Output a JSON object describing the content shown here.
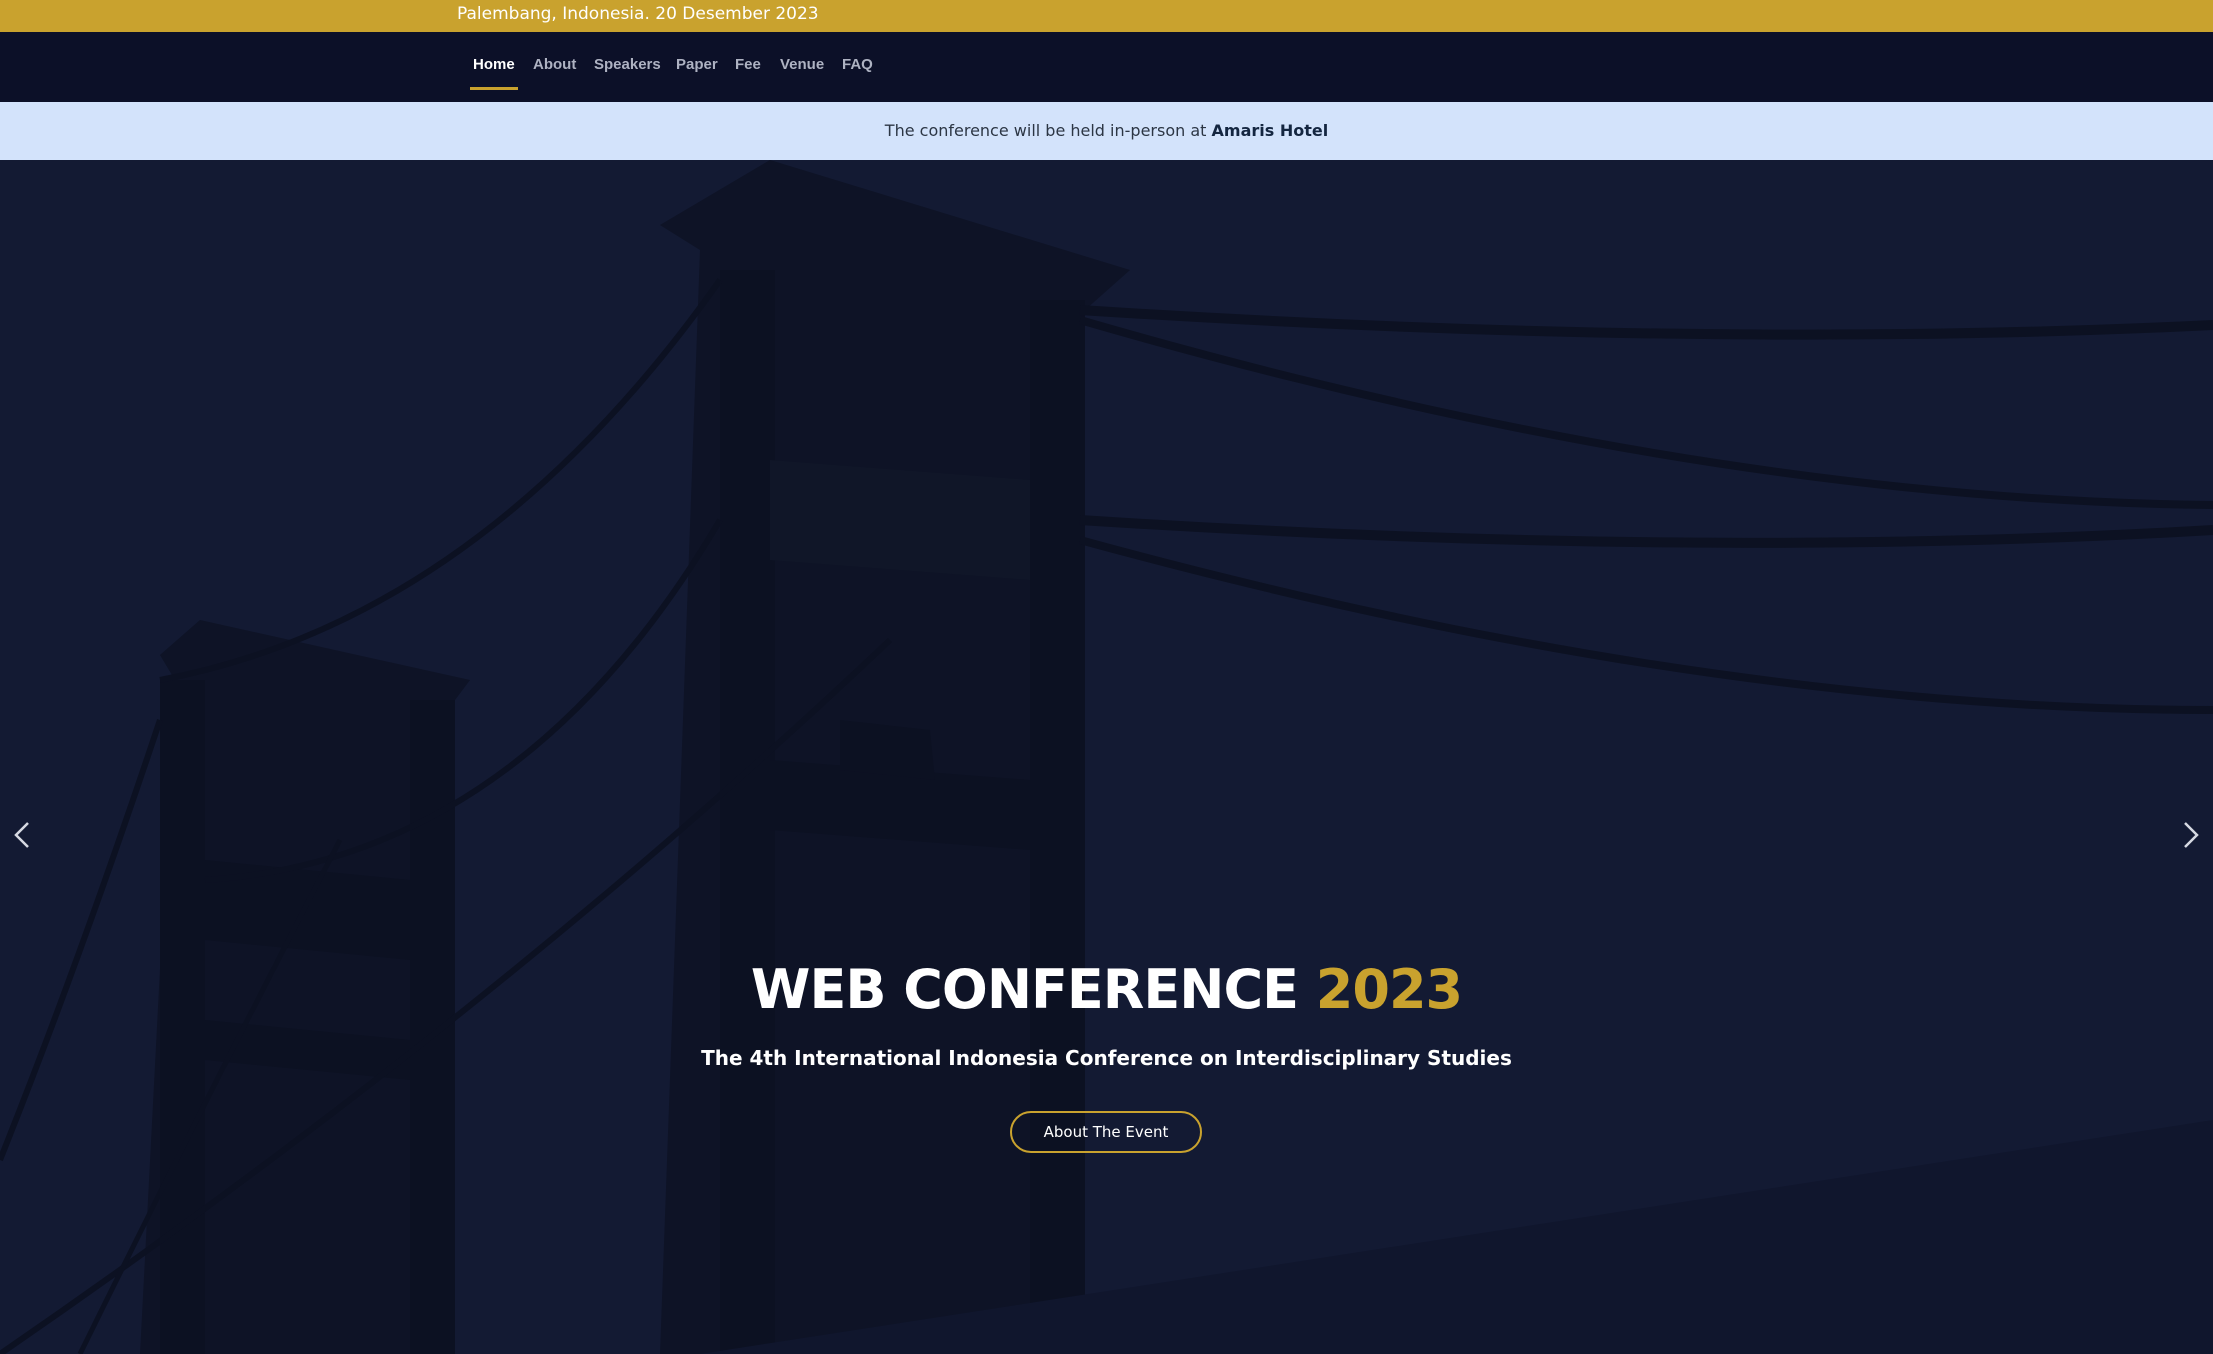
{
  "topbar": {
    "location_date": "Palembang, Indonesia. 20 Desember 2023"
  },
  "nav": {
    "items": [
      {
        "label": "Home",
        "active": true
      },
      {
        "label": "About"
      },
      {
        "label": "Speakers"
      },
      {
        "label": "Paper"
      },
      {
        "label": "Fee"
      },
      {
        "label": "Venue"
      },
      {
        "label": "FAQ"
      }
    ]
  },
  "announcement": {
    "text": "The conference will be held in-person at",
    "venue": "Amaris Hotel"
  },
  "hero": {
    "title_main": "WEB CONFERENCE",
    "title_year": "2023",
    "subtitle": "The 4th International Indonesia Conference on Interdisciplinary Studies",
    "button_label": "About The Event",
    "prev_icon": "chevron-left-icon",
    "next_icon": "chevron-right-icon"
  },
  "colors": {
    "accent": "#c9a22e",
    "navbar": "#0c1028",
    "hero_bg": "#131a33",
    "announcement_bg": "#d3e3fb"
  }
}
